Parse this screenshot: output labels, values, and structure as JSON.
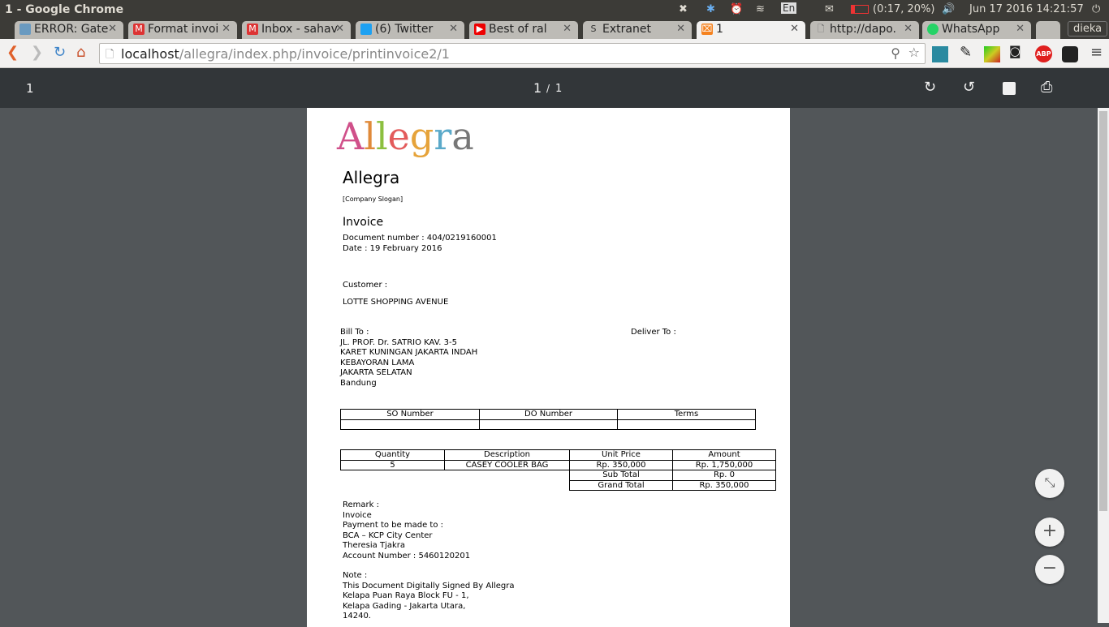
{
  "window": {
    "title": "1 - Google Chrome",
    "tray": {
      "language": "En",
      "battery": "(0:17, 20%)",
      "clock": "Jun 17 2016 14:21:57"
    }
  },
  "tabs": [
    {
      "label": "ERROR: Gate",
      "icon": "bdi-icon"
    },
    {
      "label": "Format invoi",
      "icon": "gmail-icon"
    },
    {
      "label": "Inbox - sahav",
      "icon": "gmail-icon"
    },
    {
      "label": "(6) Twitter",
      "icon": "twitter-icon"
    },
    {
      "label": "Best of ral",
      "icon": "youtube-icon"
    },
    {
      "label": "Extranet",
      "icon": "s-icon"
    },
    {
      "label": "1",
      "icon": "xampp-icon"
    },
    {
      "label": "http://dapo.",
      "icon": "page-icon"
    },
    {
      "label": "WhatsApp",
      "icon": "whatsapp-icon"
    }
  ],
  "profile": "dieka",
  "url": {
    "host": "localhost",
    "path": "/allegra/index.php/invoice/printinvoice2/1"
  },
  "pdf": {
    "title": "1",
    "page": "1",
    "sep": "/",
    "total": "1"
  },
  "invoice": {
    "logo_text": "Allegra",
    "company": "Allegra",
    "slogan": "[Company Slogan]",
    "heading": "Invoice",
    "doc_number": "Document number : 404/0219160001",
    "date": "Date : 19 February 2016",
    "customer_label": "Customer :",
    "customer": "LOTTE SHOPPING AVENUE",
    "bill_to_label": "Bill To :",
    "bill_to": [
      "JL. PROF. Dr. SATRIO KAV. 3-5",
      "KARET KUNINGAN JAKARTA INDAH",
      "KEBAYORAN LAMA",
      "JAKARTA SELATAN",
      "Bandung"
    ],
    "deliver_to_label": "Deliver To :",
    "so_table": {
      "headers": [
        "SO Number",
        "DO Number",
        "Terms"
      ],
      "row": [
        "",
        "",
        ""
      ]
    },
    "items_table": {
      "headers": [
        "Quantity",
        "Description",
        "Unit Price",
        "Amount"
      ],
      "rows": [
        [
          "5",
          "CASEY COOLER BAG",
          "Rp. 350,000",
          "Rp. 1,750,000"
        ]
      ],
      "subtotal_label": "Sub Total",
      "subtotal": "Rp. 0",
      "grand_label": "Grand Total",
      "grand": "Rp. 350,000"
    },
    "remark": [
      "Remark :",
      "Invoice",
      "Payment to be made to :",
      "BCA – KCP City Center",
      "Theresia Tjakra",
      "Account Number : 5460120201"
    ],
    "note": [
      "Note :",
      "This Document Digitally Signed By Allegra",
      "Kelapa Puan Raya Block FU - 1,",
      "Kelapa Gading - Jakarta Utara,",
      "14240."
    ]
  }
}
